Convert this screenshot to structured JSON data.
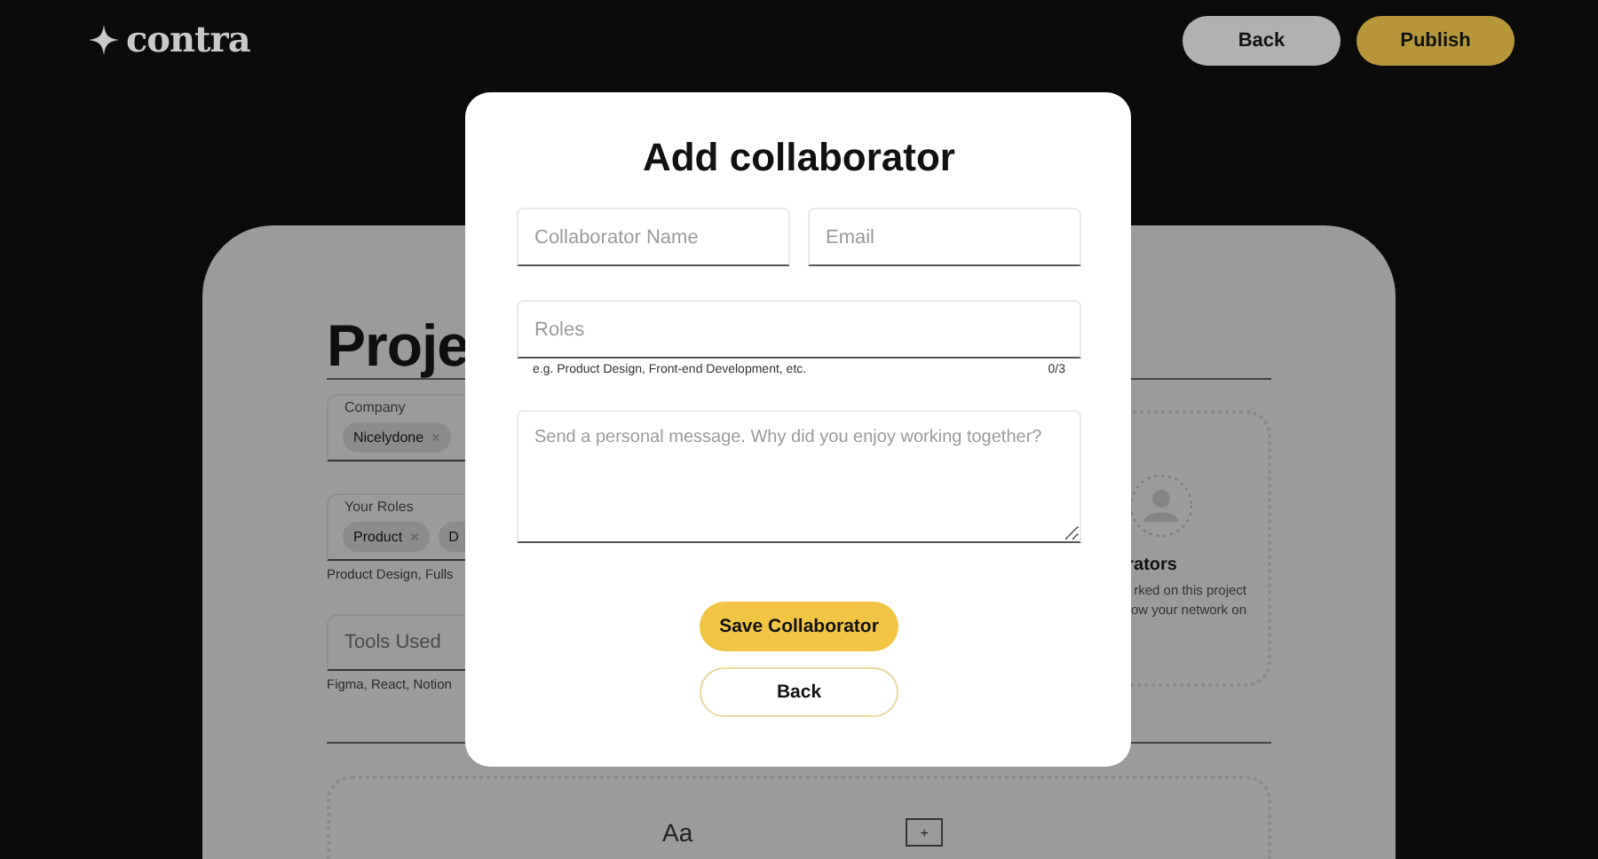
{
  "header": {
    "logo": "contra",
    "buttons": [
      {
        "label": "Back",
        "kind": "secondary"
      },
      {
        "label": "Publish",
        "kind": "primary"
      }
    ]
  },
  "page": {
    "title": "Proje",
    "fields": [
      {
        "kind": "chips",
        "label": "Company",
        "chips": [
          "Nicelydone"
        ]
      },
      {
        "kind": "chips",
        "label": "Your Roles",
        "chips": [
          "Product",
          "D"
        ],
        "hint": "Product Design, Fulls"
      },
      {
        "kind": "input",
        "placeholder": "Tools Used",
        "hint": "Figma, React, Notion"
      }
    ],
    "collaborators": {
      "title": "rators",
      "description": [
        "rked on this project",
        "ow your network on"
      ]
    },
    "editor": {
      "text_style": "Aa",
      "add": "+"
    }
  },
  "modal": {
    "title": "Add collaborator",
    "fields": [
      {
        "kind": "input",
        "placeholder": "Collaborator Name"
      },
      {
        "kind": "input",
        "placeholder": "Email"
      }
    ],
    "roles": {
      "placeholder": "Roles",
      "hint": "e.g. Product Design, Front-end Development, etc.",
      "counter": "0/3"
    },
    "message": {
      "placeholder": "Send a personal message. Why did you enjoy working together?"
    },
    "buttons": [
      {
        "label": "Save Collaborator",
        "kind": "primary"
      },
      {
        "label": "Back",
        "kind": "secondary"
      }
    ]
  }
}
